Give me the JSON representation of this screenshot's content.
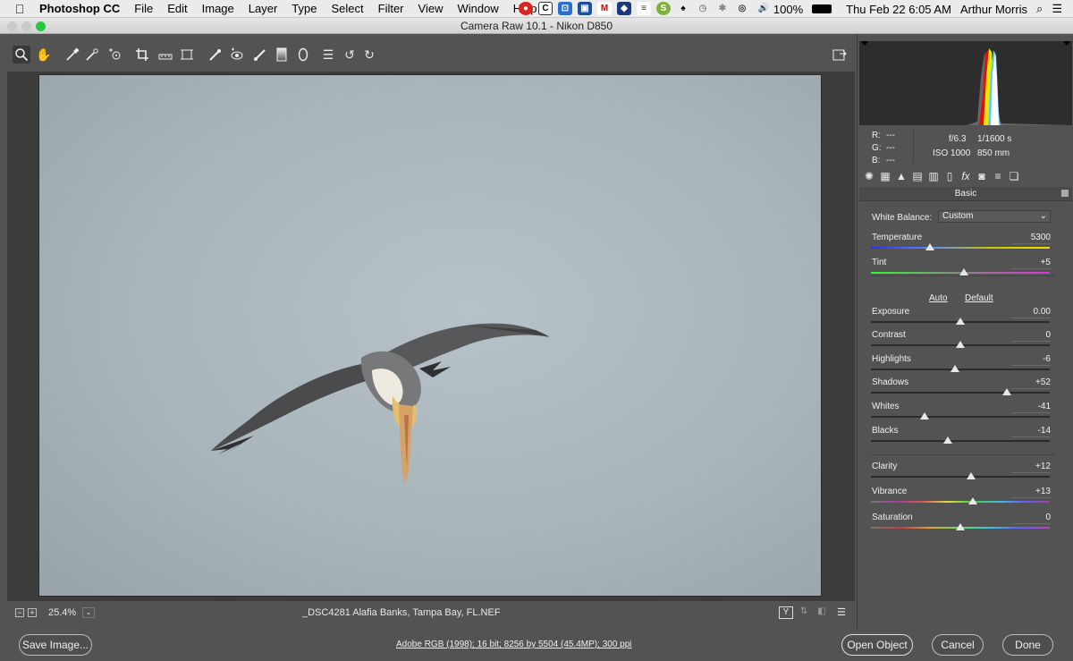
{
  "menubar": {
    "items": [
      "Photoshop CC",
      "File",
      "Edit",
      "Image",
      "Layer",
      "Type",
      "Select",
      "Filter",
      "View",
      "Window",
      "Help"
    ],
    "battery": "100%",
    "datetime": "Thu Feb 22  6:05 AM",
    "user": "Arthur Morris"
  },
  "window": {
    "title": "Camera Raw 10.1  -  Nikon D850"
  },
  "status": {
    "zoom": "25.4%",
    "filename": "_DSC4281  Alafia Banks, Tampa Bay, FL.NEF"
  },
  "bottom": {
    "save_label": "Save Image...",
    "workflow": "Adobe RGB (1998); 16 bit; 8256 by 5504 (45.4MP); 300 ppi",
    "open_label": "Open Object",
    "cancel_label": "Cancel",
    "done_label": "Done"
  },
  "info": {
    "r": "R:",
    "g": "G:",
    "b": "B:",
    "dash": "---",
    "aperture": "f/6.3",
    "shutter": "1/1600 s",
    "iso": "ISO 1000",
    "focal": "850 mm"
  },
  "panel": {
    "title": "Basic",
    "wb_label": "White Balance:",
    "wb_value": "Custom",
    "auto": "Auto",
    "default": "Default",
    "sliders": [
      {
        "label": "Temperature",
        "value": "5300",
        "pos": 0.33
      },
      {
        "label": "Tint",
        "value": "+5",
        "pos": 0.52
      },
      {
        "label": "Exposure",
        "value": "0.00",
        "pos": 0.5
      },
      {
        "label": "Contrast",
        "value": "0",
        "pos": 0.5
      },
      {
        "label": "Highlights",
        "value": "-6",
        "pos": 0.47
      },
      {
        "label": "Shadows",
        "value": "+52",
        "pos": 0.76
      },
      {
        "label": "Whites",
        "value": "-41",
        "pos": 0.3
      },
      {
        "label": "Blacks",
        "value": "-14",
        "pos": 0.43
      },
      {
        "label": "Clarity",
        "value": "+12",
        "pos": 0.56
      },
      {
        "label": "Vibrance",
        "value": "+13",
        "pos": 0.57
      },
      {
        "label": "Saturation",
        "value": "0",
        "pos": 0.5
      }
    ]
  },
  "icons": [
    "zoom-icon",
    "hand-icon",
    "white-balance-icon",
    "color-sampler-icon",
    "target-adjust-icon",
    "crop-icon",
    "straighten-icon",
    "transform-icon",
    "spot-removal-icon",
    "red-eye-icon",
    "adjustment-brush-icon",
    "graduated-filter-icon",
    "radial-filter-icon",
    "preferences-icon",
    "rotate-ccw-icon",
    "rotate-cw-icon"
  ]
}
